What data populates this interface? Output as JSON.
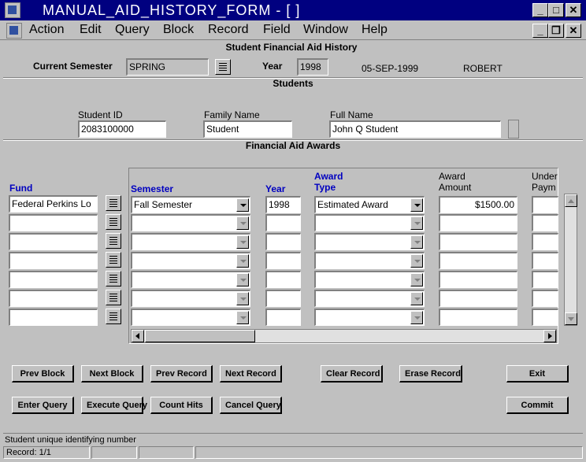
{
  "window": {
    "title": "MANUAL_AID_HISTORY_FORM - [ ]"
  },
  "menu": [
    "Action",
    "Edit",
    "Query",
    "Block",
    "Record",
    "Field",
    "Window",
    "Help"
  ],
  "form": {
    "heading": "Student Financial Aid History",
    "current_semester_label": "Current Semester",
    "current_semester_value": "SPRING",
    "year_label": "Year",
    "year_value": "1998",
    "date": "05-SEP-1999",
    "user": "ROBERT"
  },
  "students": {
    "heading": "Students",
    "student_id_label": "Student ID",
    "student_id_value": "2083100000",
    "family_name_label": "Family Name",
    "family_name_value": "Student",
    "full_name_label": "Full Name",
    "full_name_value": "John Q Student"
  },
  "awards": {
    "heading": "Financial Aid Awards",
    "columns": {
      "fund": "Fund",
      "semester": "Semester",
      "year": "Year",
      "award_type_1": "Award",
      "award_type_2": "Type",
      "award_amount_1": "Award",
      "award_amount_2": "Amount",
      "under_pay_1": "Under",
      "under_pay_2": "Paym"
    },
    "rows": [
      {
        "fund": "Federal Perkins Lo",
        "semester": "Fall Semester",
        "year": "1998",
        "award_type": "Estimated Award",
        "amount": "$1500.00"
      },
      {
        "fund": "",
        "semester": "",
        "year": "",
        "award_type": "",
        "amount": ""
      },
      {
        "fund": "",
        "semester": "",
        "year": "",
        "award_type": "",
        "amount": ""
      },
      {
        "fund": "",
        "semester": "",
        "year": "",
        "award_type": "",
        "amount": ""
      },
      {
        "fund": "",
        "semester": "",
        "year": "",
        "award_type": "",
        "amount": ""
      },
      {
        "fund": "",
        "semester": "",
        "year": "",
        "award_type": "",
        "amount": ""
      },
      {
        "fund": "",
        "semester": "",
        "year": "",
        "award_type": "",
        "amount": ""
      }
    ]
  },
  "buttons": {
    "prev_block": "Prev Block",
    "next_block": "Next Block",
    "prev_record": "Prev Record",
    "next_record": "Next Record",
    "clear_record": "Clear Record",
    "erase_record": "Erase Record",
    "exit": "Exit",
    "enter_query": "Enter Query",
    "execute_query": "Execute Query",
    "count_hits": "Count Hits",
    "cancel_query": "Cancel Query",
    "commit": "Commit"
  },
  "status": {
    "hint": "Student unique identifying number",
    "record": "Record: 1/1"
  },
  "colors": {
    "titlebar": "#000080",
    "face": "#c0c0c0",
    "label_blue": "#0000c0"
  }
}
